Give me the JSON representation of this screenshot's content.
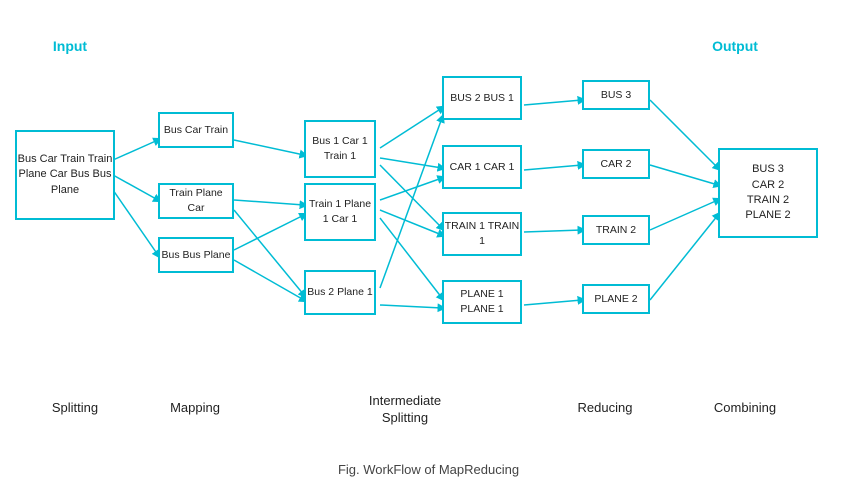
{
  "title": "Fig. WorkFlow of MapReducing",
  "sections": {
    "input_label": "Input",
    "output_label": "Output",
    "splitting_label": "Splitting",
    "mapping_label": "Mapping",
    "intermediate_label": "Intermediate\nSplitting",
    "reducing_label": "Reducing",
    "combining_label": "Combining"
  },
  "boxes": {
    "input": "Bus Car Train\nTrain Plane Car\nBus Bus Plane",
    "map1": "Bus Car Train",
    "map2": "Train Plane Car",
    "map3": "Bus Bus Plane",
    "split1": "Bus 1\nCar 1\nTrain 1",
    "split2": "Train 1\nPlane 1\nCar 1",
    "split3": "Bus 2\nPlane 1",
    "inter1": "BUS 2\nBUS 1",
    "inter2": "CAR 1\nCAR 1",
    "inter3": "TRAIN 1\nTRAIN 1",
    "inter4": "PLANE 1\nPLANE 1",
    "reduce1": "BUS 3",
    "reduce2": "CAR  2",
    "reduce3": "TRAIN 2",
    "reduce4": "PLANE 2",
    "output": "BUS 3\nCAR 2\nTRAIN 2\nPLANE 2"
  }
}
